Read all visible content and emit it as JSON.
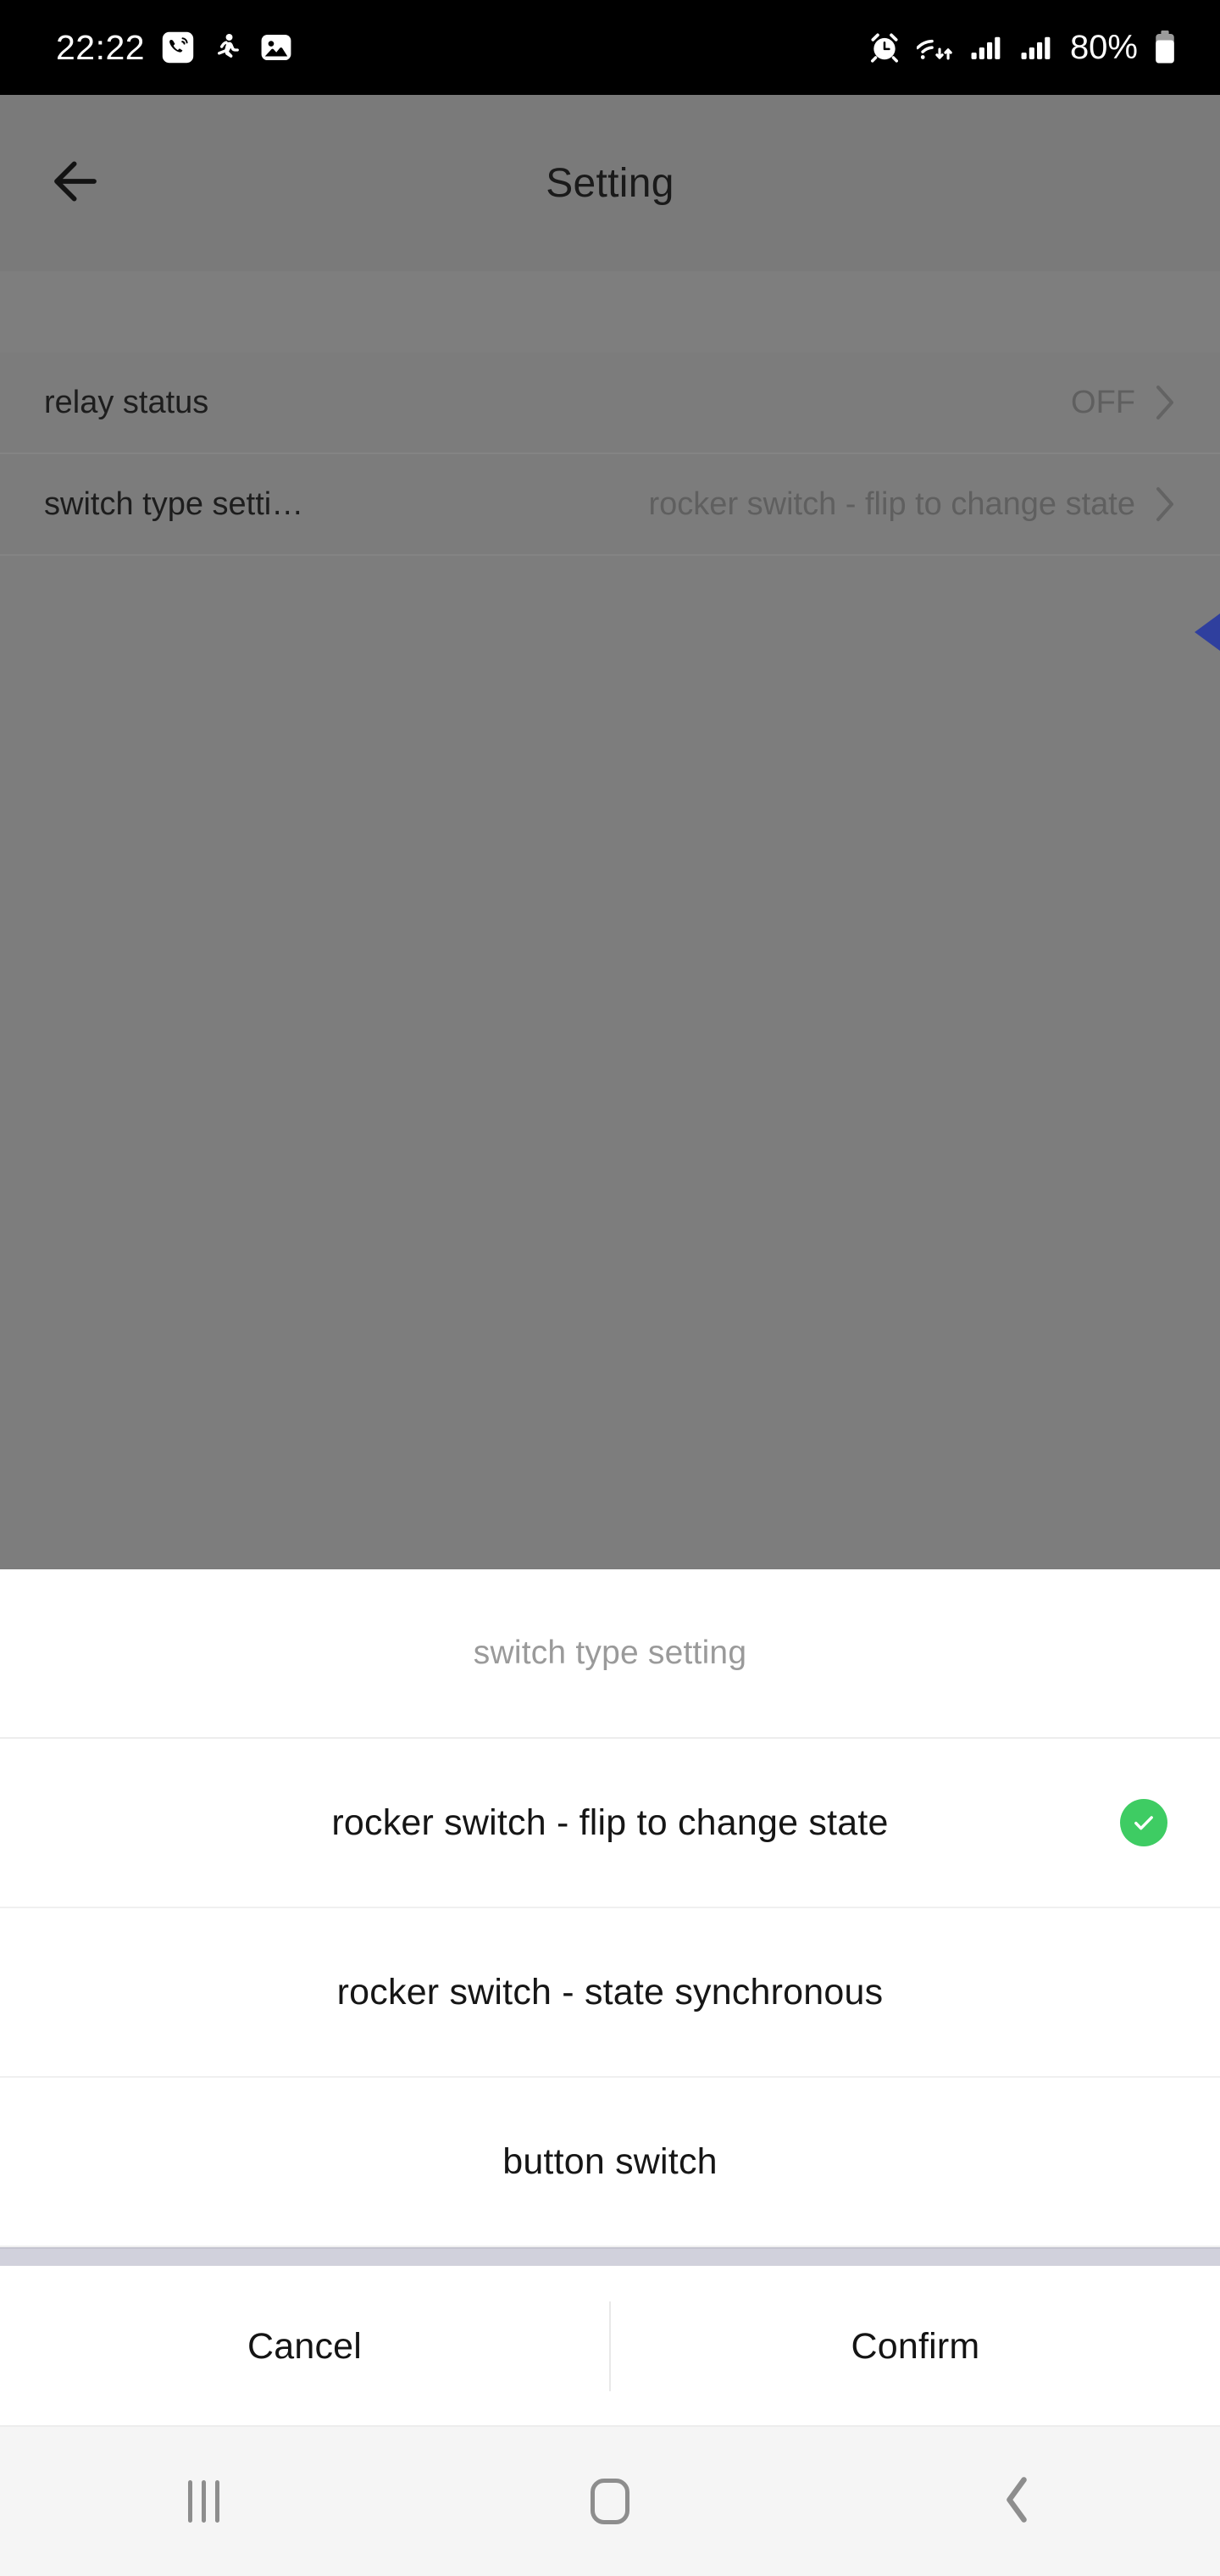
{
  "status_bar": {
    "time": "22:22",
    "battery_percent": "80%",
    "left_icons": [
      "call-recording-icon",
      "running-person-icon",
      "gallery-image-icon"
    ],
    "right_icons": [
      "alarm-clock-icon",
      "wifi-icon",
      "signal-sim1-icon",
      "signal-sim2-icon",
      "battery-icon"
    ]
  },
  "app": {
    "title": "Setting",
    "back_icon": "arrow-left-icon",
    "rows": [
      {
        "label": "relay status",
        "value": "OFF",
        "chevron": "chevron-right-icon"
      },
      {
        "label": "switch type setti…",
        "value": "rocker switch - flip to change state",
        "chevron": "chevron-right-icon"
      }
    ],
    "cursor_icon": "triangle-left-cursor"
  },
  "sheet": {
    "title": "switch type setting",
    "options": [
      {
        "label": "rocker switch - flip to change state",
        "selected": true,
        "check_icon": "check-circle-icon"
      },
      {
        "label": "rocker switch - state synchronous",
        "selected": false
      },
      {
        "label": "button switch",
        "selected": false
      }
    ],
    "cancel_label": "Cancel",
    "confirm_label": "Confirm"
  },
  "nav_bar": {
    "recents_icon": "recents-icon",
    "home_icon": "home-icon",
    "back_icon": "nav-back-chevron-icon"
  },
  "colors": {
    "accent_green": "#3ecc63",
    "cursor_blue": "#2f3f9e",
    "scrim": "#7c7c7c",
    "nav_background": "#f5f5f5"
  }
}
